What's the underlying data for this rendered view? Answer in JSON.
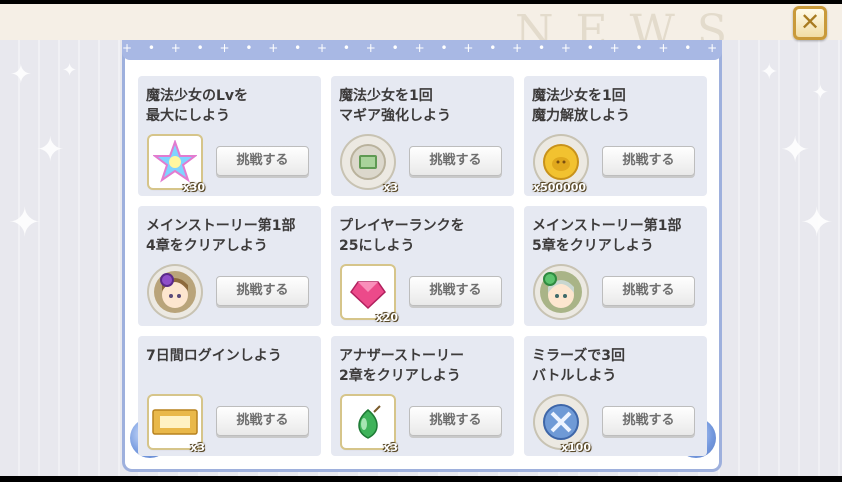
{
  "header": {
    "watermark": "NEWS",
    "close_label": "✕"
  },
  "missions": [
    {
      "title": "魔法少女のLvを\n最大にしよう",
      "reward_icon": "rainbow-star-crystal-icon",
      "quantity": "x30",
      "button": "挑戦する"
    },
    {
      "title": "魔法少女を1回\nマギア強化しよう",
      "reward_icon": "green-scroll-coin-icon",
      "quantity": "x3",
      "button": "挑戦する"
    },
    {
      "title": "魔法少女を1回\n魔力解放しよう",
      "reward_icon": "gold-coin-icon",
      "quantity": "x500000",
      "button": "挑戦する"
    },
    {
      "title": "メインストーリー第1部\n4章をクリアしよう",
      "reward_icon": "chibi-character-purple-icon",
      "quantity": "",
      "button": "挑戦する"
    },
    {
      "title": "プレイヤーランクを\n25にしよう",
      "reward_icon": "pink-gem-icon",
      "quantity": "x20",
      "button": "挑戦する"
    },
    {
      "title": "メインストーリー第1部\n5章をクリアしよう",
      "reward_icon": "chibi-character-green-icon",
      "quantity": "",
      "button": "挑戦する"
    },
    {
      "title": "7日間ログインしよう",
      "reward_icon": "gold-ticket-icon",
      "quantity": "x3",
      "button": "挑戦する"
    },
    {
      "title": "アナザーストーリー\n2章をクリアしよう",
      "reward_icon": "green-drop-icon",
      "quantity": "x3",
      "button": "挑戦する"
    },
    {
      "title": "ミラーズで3回\nバトルしよう",
      "reward_icon": "blue-sword-coin-icon",
      "quantity": "x100",
      "button": "挑戦する"
    }
  ]
}
